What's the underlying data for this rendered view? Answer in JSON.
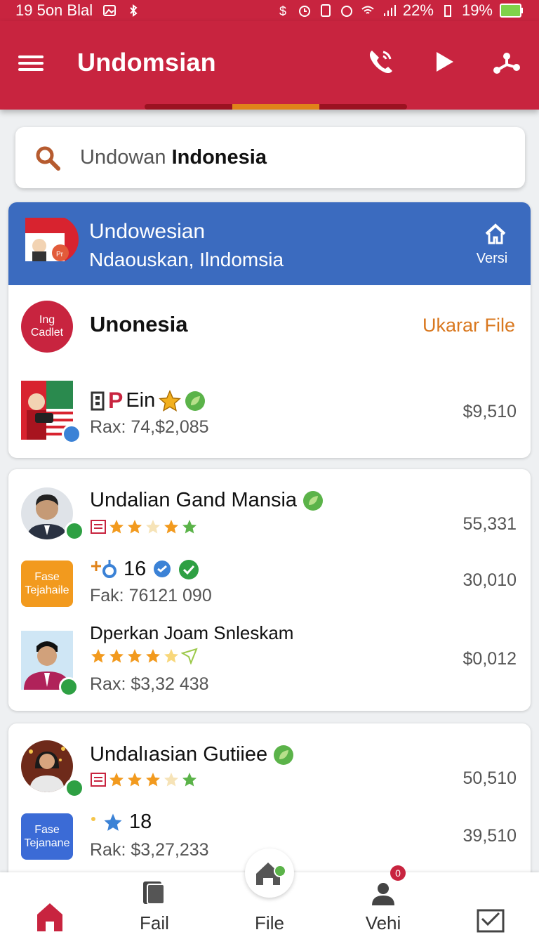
{
  "status": {
    "time": "19 5on Blal",
    "battery1": "22%",
    "battery2": "19%"
  },
  "appbar": {
    "title": "Undomsian"
  },
  "search": {
    "prefix": "Undowan ",
    "query": "Indonesia"
  },
  "header_card": {
    "title": "Undowesian",
    "subtitle": "Ndaouskan, Ilndomsia",
    "versi": "Versi"
  },
  "section": {
    "badge_line1": "Ing",
    "badge_line2": "Cadlet",
    "title": "Unonesia",
    "action": "Ukarar File",
    "item": {
      "name_red": "P",
      "name_rest": "Ein",
      "sub": "Rax: 74,$2,085",
      "value": "$9,510"
    }
  },
  "list1": [
    {
      "name": "Undalian Gand Mansia",
      "value": "55,331",
      "rating": 3.5
    },
    {
      "badge": "Fase Tejahaile",
      "name": "16",
      "sub": "Fak: 76121 090",
      "value": "30,010"
    },
    {
      "name": "Dperkan Joam Snleskam",
      "sub": "Rax: $3,32 438",
      "value": "$0,012",
      "rating": 4
    }
  ],
  "list2": [
    {
      "name": "Undalıasian Gutiiee",
      "value": "50,510",
      "rating": 4
    },
    {
      "badge": "Fase Tejanane",
      "name": "18",
      "sub": "Rak: $3,27,233",
      "value": "39,510"
    }
  ],
  "bottom_nav": {
    "home": "",
    "fail": "Fail",
    "file": "File",
    "vehi": "Vehi",
    "notif_count": "0"
  },
  "colors": {
    "primary": "#c8243f",
    "blue": "#3b6bbf",
    "accent": "#e0831a",
    "green": "#2ea043"
  }
}
